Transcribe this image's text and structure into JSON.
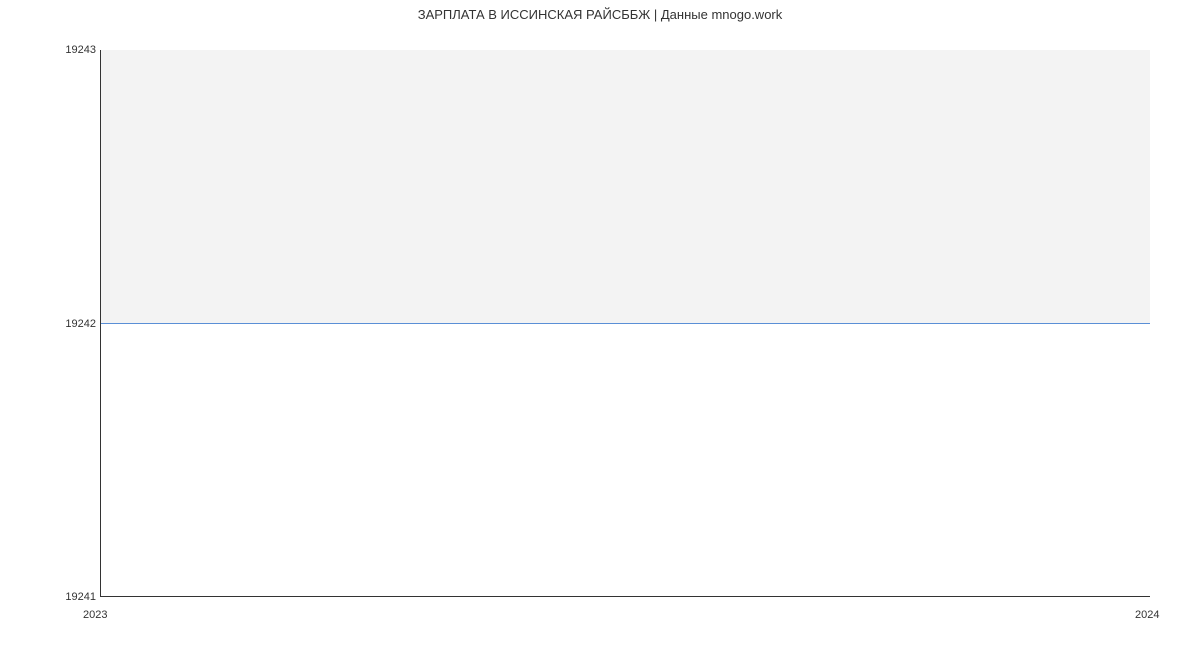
{
  "chart_data": {
    "type": "area",
    "title": "ЗАРПЛАТА В ИССИНСКАЯ РАЙСББЖ | Данные mnogo.work",
    "x": [
      2023,
      2024
    ],
    "values": [
      19242,
      19242
    ],
    "xlabel": "",
    "ylabel": "",
    "ylim": [
      19241,
      19243
    ],
    "y_ticks": [
      19241,
      19242,
      19243
    ],
    "x_ticks": [
      2023,
      2024
    ],
    "fill_above": true,
    "line_color": "#5a8fd6",
    "fill_color": "#f3f3f3"
  }
}
